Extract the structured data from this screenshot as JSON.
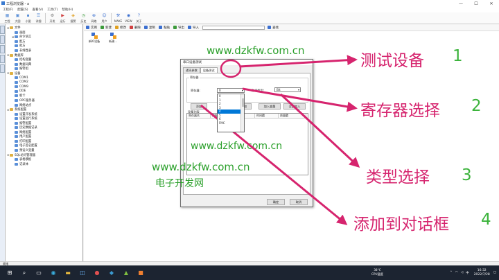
{
  "window": {
    "title": "工程浏览器 - a",
    "min": "—",
    "max": "☐",
    "close": "✕"
  },
  "menu": [
    "工程(F)",
    "配置(S)",
    "查看(V)",
    "工具(T)",
    "帮助(H)"
  ],
  "toolbar": [
    {
      "label": "工程",
      "icon": "grid",
      "color": "#5a8fd8"
    },
    {
      "label": "大图",
      "icon": "large",
      "color": "#5a8fd8"
    },
    {
      "label": "小图",
      "icon": "small",
      "color": "#5a8fd8"
    },
    {
      "label": "详细",
      "icon": "detail",
      "color": "#5a8fd8"
    },
    {
      "label": "开发",
      "icon": "gear",
      "color": "#777"
    },
    {
      "label": "运行",
      "icon": "play",
      "color": "#d04040"
    },
    {
      "label": "报警",
      "icon": "bell",
      "color": "#e0a020"
    },
    {
      "label": "历史",
      "icon": "history",
      "color": "#3a9a3a"
    },
    {
      "label": "网络",
      "icon": "network",
      "color": "#3b6fd0"
    },
    {
      "label": "用户",
      "icon": "user",
      "color": "#3b6fd0"
    },
    {
      "label": "MAKE",
      "icon": "make",
      "color": "#3b6fd0"
    },
    {
      "label": "VIEW",
      "icon": "view",
      "color": "#3b6fd0"
    },
    {
      "label": "关于",
      "icon": "about",
      "color": "#3b6fd0"
    }
  ],
  "tree": [
    {
      "label": "文件",
      "level": 0,
      "exp": "⊟",
      "color": "#e0b040"
    },
    {
      "label": "画面",
      "level": 1,
      "exp": "",
      "color": "#5a8fd8"
    },
    {
      "label": "命令语言",
      "level": 1,
      "exp": "⊞",
      "color": "#5a8fd8"
    },
    {
      "label": "配方",
      "level": 1,
      "exp": "",
      "color": "#5a8fd8"
    },
    {
      "label": "批方",
      "level": 1,
      "exp": "",
      "color": "#5a8fd8"
    },
    {
      "label": "非线性表",
      "level": 1,
      "exp": "",
      "color": "#5a8fd8"
    },
    {
      "label": "数据库",
      "level": 0,
      "exp": "⊟",
      "color": "#e0b040"
    },
    {
      "label": "结构变量",
      "level": 1,
      "exp": "",
      "color": "#5a8fd8"
    },
    {
      "label": "数据词典",
      "level": 1,
      "exp": "",
      "color": "#5a8fd8"
    },
    {
      "label": "报警组",
      "level": 1,
      "exp": "",
      "color": "#5a8fd8"
    },
    {
      "label": "设备",
      "level": 0,
      "exp": "⊟",
      "color": "#e0b040"
    },
    {
      "label": "COM1",
      "level": 1,
      "exp": "",
      "color": "#5a8fd8"
    },
    {
      "label": "COM2",
      "level": 1,
      "exp": "",
      "color": "#5a8fd8"
    },
    {
      "label": "COM9",
      "level": 1,
      "exp": "",
      "color": "#5a8fd8"
    },
    {
      "label": "DDE",
      "level": 1,
      "exp": "",
      "color": "#5a8fd8"
    },
    {
      "label": "板卡",
      "level": 1,
      "exp": "",
      "color": "#5a8fd8"
    },
    {
      "label": "OPC服务器",
      "level": 1,
      "exp": "",
      "color": "#5a8fd8"
    },
    {
      "label": "网络站点",
      "level": 1,
      "exp": "",
      "color": "#5a8fd8"
    },
    {
      "label": "系统配置",
      "level": 0,
      "exp": "⊟",
      "color": "#e0b040"
    },
    {
      "label": "设置开发系统",
      "level": 1,
      "exp": "",
      "color": "#5a8fd8"
    },
    {
      "label": "设置运行系统",
      "level": 1,
      "exp": "",
      "color": "#5a8fd8"
    },
    {
      "label": "报警配置",
      "level": 1,
      "exp": "",
      "color": "#5a8fd8"
    },
    {
      "label": "历史数据记录",
      "level": 1,
      "exp": "",
      "color": "#5a8fd8"
    },
    {
      "label": "网络配置",
      "level": 1,
      "exp": "",
      "color": "#5a8fd8"
    },
    {
      "label": "用户配置",
      "level": 1,
      "exp": "",
      "color": "#5a8fd8"
    },
    {
      "label": "打印配置",
      "level": 1,
      "exp": "",
      "color": "#5a8fd8"
    },
    {
      "label": "电子签名配置",
      "level": 1,
      "exp": "",
      "color": "#5a8fd8"
    },
    {
      "label": "预设义变量",
      "level": 1,
      "exp": "",
      "color": "#5a8fd8"
    },
    {
      "label": "SQL访问管理器",
      "level": 0,
      "exp": "⊟",
      "color": "#e0b040"
    },
    {
      "label": "表格模板",
      "level": 1,
      "exp": "",
      "color": "#5a8fd8"
    },
    {
      "label": "记录体",
      "level": 1,
      "exp": "",
      "color": "#5a8fd8"
    }
  ],
  "content_toolbar": {
    "buttons": [
      "实例",
      "新建",
      "修改",
      "删除",
      "复制",
      "粘贴",
      "导出",
      "导入"
    ],
    "search_label": "查找"
  },
  "devices": [
    "新IO设备",
    "新建..."
  ],
  "status": "就绪",
  "dialog": {
    "title": "串口设备测试",
    "tabs": [
      "通讯参数",
      "设备测试"
    ],
    "group_label": "寄存器",
    "register_label": "寄存器:",
    "register_value": "0",
    "type_label": "数据类型:",
    "type_value": "Bit",
    "options": [
      "0",
      "1",
      "2",
      "3",
      "4",
      "5",
      "6",
      "FMC"
    ],
    "selected_index": 4,
    "add_button": "添加",
    "read_button": "读取",
    "add_var_button": "加入变量",
    "add_all_button": "全部加入",
    "list_label": "采集列表",
    "columns": [
      "寄存器名",
      "数据类型",
      "变量值",
      "时间戳",
      "质量戳"
    ],
    "ok_button": "确定",
    "cancel_button": "取消"
  },
  "taskbar": {
    "weather_temp": "38°C",
    "weather_text": "CPU温度",
    "ime": "中",
    "time": "16:32",
    "date": "2022/7/28"
  },
  "watermarks": [
    "www.dzkfw.com.cn",
    "www.dzkfw.com.cn",
    "www.dzkfw.com.cn",
    "电子开发网"
  ],
  "annotations": [
    {
      "text": "测试设备",
      "num": "1"
    },
    {
      "text": "寄存器选择",
      "num": "2"
    },
    {
      "text": "类型选择",
      "num": "3"
    },
    {
      "text": "添加到对话框",
      "num": "4"
    }
  ],
  "colors": {
    "annotation": "#d6246e",
    "number": "#3bb33b",
    "watermark": "#2ba02b",
    "selection": "#0078d7"
  }
}
